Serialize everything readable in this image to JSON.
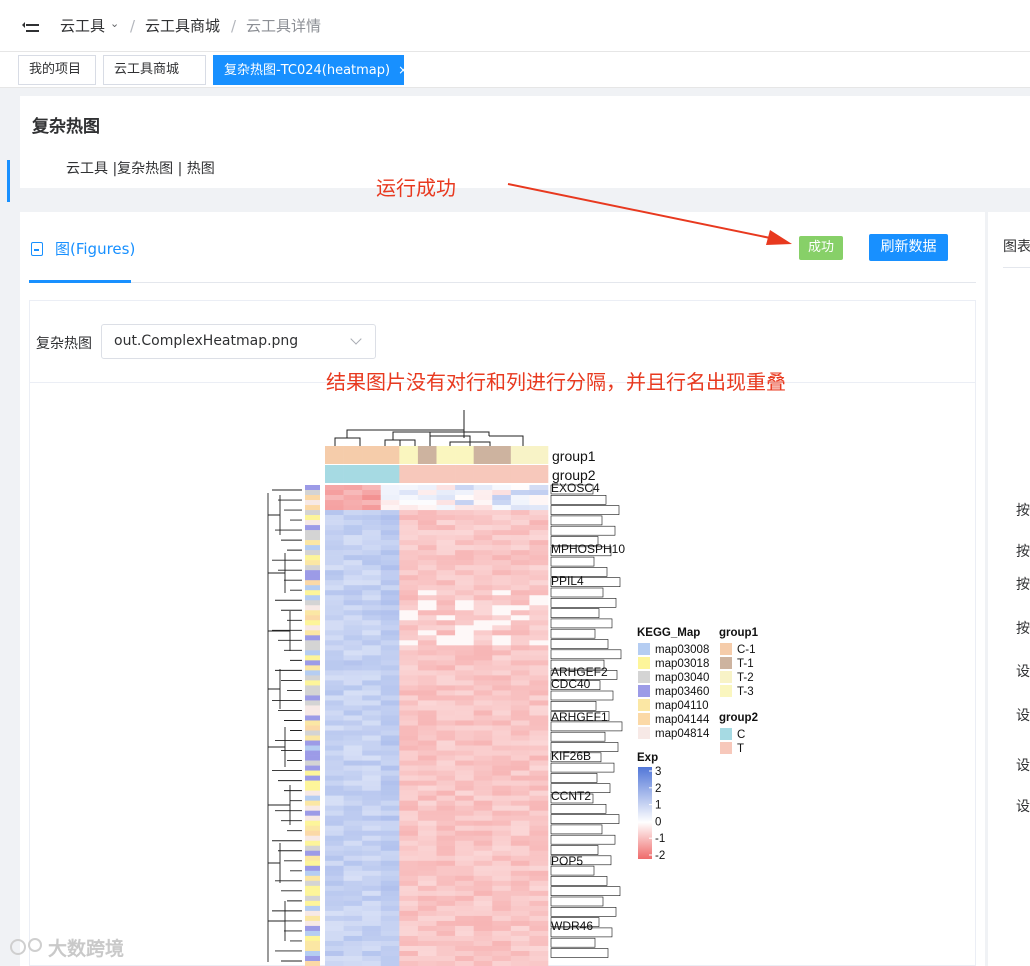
{
  "breadcrumb": [
    "云工具",
    "云工具商城",
    "云工具详情"
  ],
  "tabs": [
    {
      "label": "我的项目"
    },
    {
      "label": "云工具商城"
    },
    {
      "label": "复杂热图-TC024(heatmap)",
      "close": "×"
    }
  ],
  "page": {
    "title": "复杂热图",
    "crumb": "云工具 |复杂热图 | 热图"
  },
  "figures_tab": {
    "label": "图(Figures)"
  },
  "buttons": {
    "success": "成功",
    "refresh": "刷新数据"
  },
  "select": {
    "label": "复杂热图",
    "value": "out.ComplexHeatmap.png"
  },
  "annotations": {
    "run_success": "运行成功",
    "issue": "结果图片没有对行和列进行分隔，并且行名出现重叠"
  },
  "side_panel": {
    "title": "图表",
    "items": [
      "按",
      "按",
      "按",
      "按",
      "设",
      "设",
      "设",
      "设"
    ]
  },
  "watermark": "大数跨境",
  "colors": {
    "primary": "#1890ff",
    "success": "#87d068",
    "annotation": "#e8391f"
  },
  "chart_data": {
    "type": "heatmap",
    "column_annotations": [
      {
        "name": "group1",
        "values": [
          "C-1",
          "T-1",
          "T-2",
          "T-3"
        ]
      },
      {
        "name": "group2",
        "values": [
          "C",
          "T"
        ]
      }
    ],
    "visible_row_labels": [
      "EXOSC4",
      "MPHOSPH10",
      "PPIL4",
      "ARHGEF2",
      "CDC40",
      "ARHGEF1",
      "KIF26B",
      "CCNT2",
      "POP5",
      "WDR46"
    ],
    "legends": [
      {
        "title": "KEGG_Map",
        "entries": [
          {
            "label": "map03008",
            "color": "#b5cdf2"
          },
          {
            "label": "map03018",
            "color": "#fdf59a"
          },
          {
            "label": "map03040",
            "color": "#d4d4d4"
          },
          {
            "label": "map03460",
            "color": "#9c9be7"
          },
          {
            "label": "map04110",
            "color": "#fbe7a4"
          },
          {
            "label": "map04144",
            "color": "#fbd9a7"
          },
          {
            "label": "map04814",
            "color": "#f7e9e6"
          }
        ]
      },
      {
        "title": "group1",
        "entries": [
          {
            "label": "C-1",
            "color": "#f5ccaa"
          },
          {
            "label": "T-1",
            "color": "#cdb39f"
          },
          {
            "label": "T-2",
            "color": "#f8f3c7"
          },
          {
            "label": "T-3",
            "color": "#faf6bf"
          }
        ]
      },
      {
        "title": "group2",
        "entries": [
          {
            "label": "C",
            "color": "#a6dae3"
          },
          {
            "label": "T",
            "color": "#f7c8bb"
          }
        ]
      },
      {
        "title": "Exp",
        "scale": {
          "min": -2,
          "max": 3,
          "ticks": [
            "3",
            "2",
            "1",
            "0",
            "-1",
            "-2"
          ],
          "colors": [
            "#5277d8",
            "#ffffff",
            "#ef6b6b"
          ]
        }
      }
    ]
  }
}
